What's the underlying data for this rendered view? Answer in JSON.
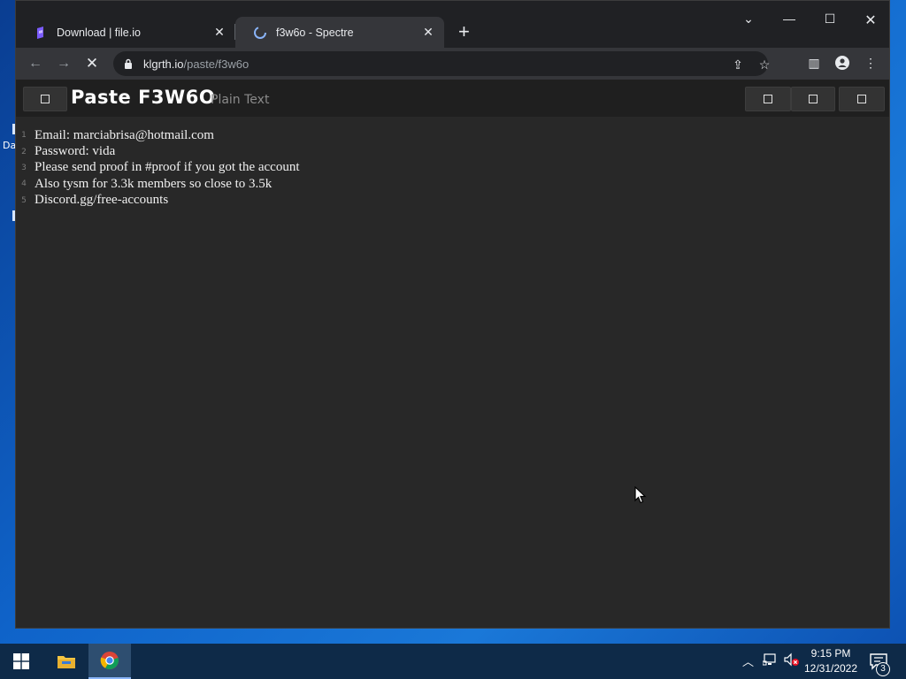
{
  "browser": {
    "tabs": [
      {
        "title": "Download | file.io",
        "active": false
      },
      {
        "title": "f3w6o - Spectre",
        "active": true
      }
    ],
    "new_tab_icon": "plus-icon",
    "window_controls": [
      "chevron-down-icon",
      "minimize-icon",
      "maximize-icon",
      "close-icon"
    ],
    "url_host": "klgrth.io",
    "url_path": "/paste/f3w6o",
    "loading": true
  },
  "paste": {
    "title": "Paste F3W6O",
    "type": "Plain Text",
    "lines": [
      {
        "num": "1",
        "text": "Email: marciabrisa@hotmail.com"
      },
      {
        "num": "2",
        "text": "Password: vida"
      },
      {
        "num": "3",
        "text": "Please send proof in #proof if you got the account"
      },
      {
        "num": "4",
        "text": "Also tysm for 3.3k members so close to 3.5k"
      },
      {
        "num": "5",
        "text": "Discord.gg/free-accounts"
      }
    ]
  },
  "desktop": {
    "peek_text": "Da"
  },
  "taskbar": {
    "apps": [
      "file-explorer-icon",
      "chrome-icon"
    ],
    "time": "9:15 PM",
    "date": "12/31/2022",
    "notification_count": "3"
  },
  "colors": {
    "tab_bg": "#202124",
    "active_tab": "#35363a",
    "page_bg": "#282828",
    "header_bg": "#1f1f1f",
    "taskbar": "#0e2a48"
  }
}
